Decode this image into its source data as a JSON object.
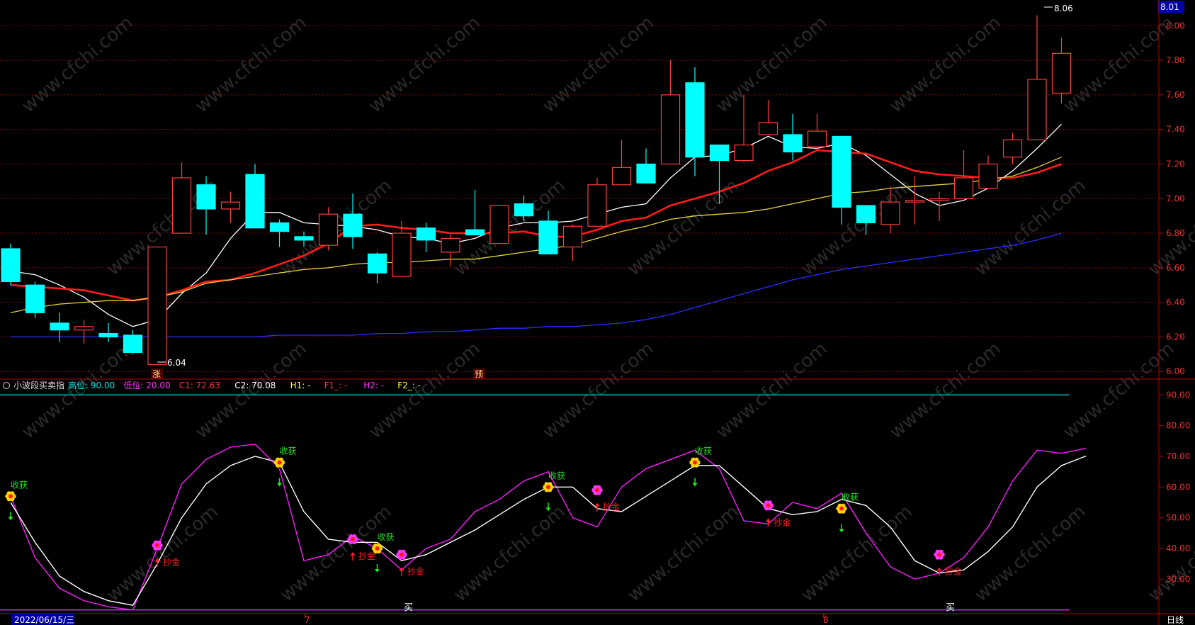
{
  "colors": {
    "up": "#ff3c3c",
    "down": "#00ffff",
    "ma5": "#ffffff",
    "ma10": "#ff1a1a",
    "ma20": "#e6d23c",
    "ma60": "#2c2cff",
    "grid": "#8c0000",
    "axis": "#b40000",
    "osc_k": "#ff1aff",
    "osc_d": "#ffffff",
    "level": "#00c8c8",
    "buy_text": "#ff2020",
    "sell_text": "#1ee61e"
  },
  "icons": {
    "up_arrow": "red-up-arrow-icon",
    "down_arrow": "green-down-arrow-icon",
    "flower": "flower-marker-icon"
  },
  "price_axis": {
    "ticks": [
      "8.00",
      "7.80",
      "7.60",
      "7.40",
      "7.20",
      "7.00",
      "6.80",
      "6.60",
      "6.40",
      "6.20",
      "6.00"
    ],
    "current": "8.01",
    "ylim": [
      5.96,
      8.12
    ]
  },
  "osc_axis": {
    "ticks": [
      "90.00",
      "80.00",
      "70.00",
      "60.00",
      "50.00",
      "40.00",
      "30.00"
    ],
    "ylim": [
      19,
      94
    ]
  },
  "header": {
    "name": "小波段买卖指",
    "items": [
      {
        "text": "高位: 90.00",
        "color": "#00e6e6"
      },
      {
        "text": "低位: 20.00",
        "color": "#ff33ff"
      },
      {
        "text": "C1: 72.63",
        "color": "#ff3333"
      },
      {
        "text": "C2: 70.08",
        "color": "#ffffff"
      },
      {
        "text": "H1: -",
        "color": "#ffff33"
      },
      {
        "text": "F1_: -",
        "color": "#ff3333"
      },
      {
        "text": "H2: -",
        "color": "#ff33ff"
      },
      {
        "text": "F2_: -",
        "color": "#ffff33"
      }
    ]
  },
  "date_axis": {
    "current_date": "2022/06/15/三",
    "month_labels": [
      "7",
      "8"
    ],
    "period": "日线"
  },
  "annotations": {
    "low": "6.04",
    "high": "8.06",
    "zhang": "涨",
    "yu": "预",
    "buy_word": "买",
    "harvest": "收获",
    "gold": "抄金"
  },
  "watermark": "www.cfchi.com",
  "chart_data": [
    {
      "type": "candlestick",
      "ylim": [
        5.96,
        8.12
      ],
      "candles": [
        {
          "o": 6.71,
          "c": 6.52,
          "h": 6.74,
          "l": 6.5
        },
        {
          "o": 6.5,
          "c": 6.34,
          "h": 6.52,
          "l": 6.31
        },
        {
          "o": 6.28,
          "c": 6.24,
          "h": 6.34,
          "l": 6.17
        },
        {
          "o": 6.24,
          "c": 6.26,
          "h": 6.3,
          "l": 6.16
        },
        {
          "o": 6.22,
          "c": 6.2,
          "h": 6.28,
          "l": 6.17
        },
        {
          "o": 6.21,
          "c": 6.11,
          "h": 6.24,
          "l": 6.1
        },
        {
          "o": 6.04,
          "c": 6.72,
          "h": 6.72,
          "l": 6.04
        },
        {
          "o": 6.8,
          "c": 7.12,
          "h": 7.21,
          "l": 6.8
        },
        {
          "o": 7.08,
          "c": 6.94,
          "h": 7.13,
          "l": 6.79
        },
        {
          "o": 6.94,
          "c": 6.98,
          "h": 7.04,
          "l": 6.86
        },
        {
          "o": 7.14,
          "c": 6.83,
          "h": 7.2,
          "l": 6.83
        },
        {
          "o": 6.86,
          "c": 6.81,
          "h": 6.88,
          "l": 6.72
        },
        {
          "o": 6.78,
          "c": 6.76,
          "h": 6.81,
          "l": 6.72
        },
        {
          "o": 6.73,
          "c": 6.91,
          "h": 6.95,
          "l": 6.7
        },
        {
          "o": 6.91,
          "c": 6.78,
          "h": 7.03,
          "l": 6.71
        },
        {
          "o": 6.68,
          "c": 6.57,
          "h": 6.69,
          "l": 6.51
        },
        {
          "o": 6.55,
          "c": 6.8,
          "h": 6.87,
          "l": 6.55
        },
        {
          "o": 6.83,
          "c": 6.76,
          "h": 6.86,
          "l": 6.69
        },
        {
          "o": 6.69,
          "c": 6.77,
          "h": 6.8,
          "l": 6.61
        },
        {
          "o": 6.82,
          "c": 6.79,
          "h": 7.05,
          "l": 6.79
        },
        {
          "o": 6.74,
          "c": 6.96,
          "h": 6.96,
          "l": 6.74
        },
        {
          "o": 6.97,
          "c": 6.9,
          "h": 7.02,
          "l": 6.87
        },
        {
          "o": 6.87,
          "c": 6.68,
          "h": 6.93,
          "l": 6.68
        },
        {
          "o": 6.72,
          "c": 6.84,
          "h": 6.85,
          "l": 6.64
        },
        {
          "o": 6.84,
          "c": 7.08,
          "h": 7.12,
          "l": 6.84
        },
        {
          "o": 7.08,
          "c": 7.18,
          "h": 7.34,
          "l": 7.08
        },
        {
          "o": 7.2,
          "c": 7.09,
          "h": 7.29,
          "l": 7.09
        },
        {
          "o": 7.2,
          "c": 7.6,
          "h": 7.8,
          "l": 7.2
        },
        {
          "o": 7.67,
          "c": 7.24,
          "h": 7.76,
          "l": 7.13
        },
        {
          "o": 7.31,
          "c": 7.22,
          "h": 7.31,
          "l": 6.97
        },
        {
          "o": 7.22,
          "c": 7.31,
          "h": 7.6,
          "l": 7.21
        },
        {
          "o": 7.37,
          "c": 7.44,
          "h": 7.57,
          "l": 7.37
        },
        {
          "o": 7.37,
          "c": 7.27,
          "h": 7.49,
          "l": 7.22
        },
        {
          "o": 7.3,
          "c": 7.39,
          "h": 7.49,
          "l": 7.28
        },
        {
          "o": 7.36,
          "c": 6.95,
          "h": 7.36,
          "l": 6.85
        },
        {
          "o": 6.96,
          "c": 6.86,
          "h": 6.96,
          "l": 6.79
        },
        {
          "o": 6.85,
          "c": 6.98,
          "h": 7.07,
          "l": 6.8
        },
        {
          "o": 6.98,
          "c": 6.99,
          "h": 7.13,
          "l": 6.85
        },
        {
          "o": 6.99,
          "c": 7.0,
          "h": 7.04,
          "l": 6.87
        },
        {
          "o": 7.0,
          "c": 7.12,
          "h": 7.28,
          "l": 7.0
        },
        {
          "o": 7.06,
          "c": 7.2,
          "h": 7.25,
          "l": 7.06
        },
        {
          "o": 7.24,
          "c": 7.34,
          "h": 7.38,
          "l": 7.2
        },
        {
          "o": 7.34,
          "c": 7.69,
          "h": 8.06,
          "l": 7.34
        },
        {
          "o": 7.61,
          "c": 7.84,
          "h": 7.93,
          "l": 7.55
        }
      ],
      "ma": [
        {
          "name": "MA5",
          "color": "#ffffff",
          "values": [
            6.58,
            6.56,
            6.5,
            6.43,
            6.33,
            6.26,
            6.3,
            6.45,
            6.57,
            6.77,
            6.92,
            6.92,
            6.86,
            6.85,
            6.84,
            6.82,
            6.78,
            6.77,
            6.74,
            6.77,
            6.83,
            6.86,
            6.86,
            6.87,
            6.91,
            6.95,
            6.97,
            7.12,
            7.24,
            7.25,
            7.29,
            7.36,
            7.3,
            7.29,
            7.32,
            7.25,
            7.14,
            7.03,
            6.96,
            6.99,
            7.06,
            7.16,
            7.29,
            7.43
          ]
        },
        {
          "name": "MA10",
          "color": "#ff1a1a",
          "values": [
            6.5,
            6.49,
            6.48,
            6.47,
            6.44,
            6.41,
            6.43,
            6.47,
            6.52,
            6.53,
            6.57,
            6.62,
            6.67,
            6.74,
            6.84,
            6.85,
            6.83,
            6.82,
            6.8,
            6.8,
            6.8,
            6.81,
            6.78,
            6.78,
            6.82,
            6.87,
            6.89,
            6.96,
            7.0,
            7.04,
            7.09,
            7.16,
            7.21,
            7.28,
            7.27,
            7.26,
            7.21,
            7.16,
            7.14,
            7.13,
            7.12,
            7.12,
            7.15,
            7.2
          ]
        },
        {
          "name": "MA20",
          "color": "#e6d23c",
          "values": [
            6.34,
            6.37,
            6.39,
            6.4,
            6.41,
            6.41,
            6.43,
            6.46,
            6.51,
            6.53,
            6.55,
            6.57,
            6.59,
            6.6,
            6.62,
            6.63,
            6.63,
            6.64,
            6.65,
            6.65,
            6.67,
            6.69,
            6.71,
            6.73,
            6.77,
            6.81,
            6.84,
            6.88,
            6.9,
            6.91,
            6.92,
            6.94,
            6.97,
            7.0,
            7.03,
            7.04,
            7.06,
            7.07,
            7.08,
            7.09,
            7.11,
            7.13,
            7.18,
            7.24
          ]
        },
        {
          "name": "MA60",
          "color": "#2c2cff",
          "values": [
            6.2,
            6.2,
            6.2,
            6.2,
            6.2,
            6.2,
            6.2,
            6.2,
            6.2,
            6.2,
            6.2,
            6.21,
            6.21,
            6.21,
            6.21,
            6.22,
            6.22,
            6.23,
            6.23,
            6.24,
            6.25,
            6.25,
            6.26,
            6.26,
            6.27,
            6.28,
            6.3,
            6.33,
            6.37,
            6.41,
            6.45,
            6.49,
            6.53,
            6.56,
            6.59,
            6.61,
            6.63,
            6.65,
            6.67,
            6.69,
            6.71,
            6.73,
            6.76,
            6.8
          ]
        }
      ]
    },
    {
      "type": "line",
      "ylim": [
        19,
        94
      ],
      "levels": [
        {
          "name": "高位",
          "value": 90
        },
        {
          "name": "低位",
          "value": 20
        }
      ],
      "series": [
        {
          "name": "C1",
          "color": "#ff1aff",
          "values": [
            57,
            37,
            27,
            23,
            21,
            20,
            40,
            61,
            69,
            73,
            74,
            66,
            36,
            38,
            44,
            40,
            33,
            40,
            43,
            52,
            56,
            62,
            65,
            50,
            47,
            60,
            66,
            69,
            72,
            66,
            49,
            48,
            55,
            53,
            58,
            45,
            34,
            30,
            32,
            37,
            47,
            62,
            72,
            71,
            72.6
          ]
        },
        {
          "name": "C2",
          "color": "#ffffff",
          "values": [
            55,
            42,
            31,
            26,
            23,
            21.5,
            35,
            50,
            61,
            67,
            70,
            68,
            52,
            43,
            42,
            42,
            36,
            38,
            42,
            46,
            51,
            56,
            60,
            60,
            53,
            52,
            57,
            62,
            67,
            67,
            60,
            53,
            51,
            52,
            56,
            54,
            47,
            36,
            32,
            33,
            39,
            47,
            60,
            67,
            70.1
          ]
        }
      ],
      "markers": [
        {
          "i": 0,
          "v": 57,
          "kind": "sell",
          "label": "收获"
        },
        {
          "i": 6,
          "v": 41,
          "kind": "buy",
          "label": "抄金"
        },
        {
          "i": 11,
          "v": 68,
          "kind": "sell",
          "label": "收获"
        },
        {
          "i": 14,
          "v": 43,
          "kind": "buy",
          "label": "抄金"
        },
        {
          "i": 15,
          "v": 40,
          "kind": "sell",
          "label": "收获"
        },
        {
          "i": 16,
          "v": 38,
          "kind": "buy",
          "label": "抄金"
        },
        {
          "i": 22,
          "v": 60,
          "kind": "sell",
          "label": "收获"
        },
        {
          "i": 24,
          "v": 59,
          "kind": "buy",
          "label": "抄金"
        },
        {
          "i": 28,
          "v": 68,
          "kind": "sell",
          "label": "收获"
        },
        {
          "i": 31,
          "v": 54,
          "kind": "buy",
          "label": "抄金"
        },
        {
          "i": 34,
          "v": 53,
          "kind": "sell",
          "label": "收获"
        },
        {
          "i": 38,
          "v": 38,
          "kind": "buy",
          "label": "抄金"
        }
      ]
    }
  ]
}
